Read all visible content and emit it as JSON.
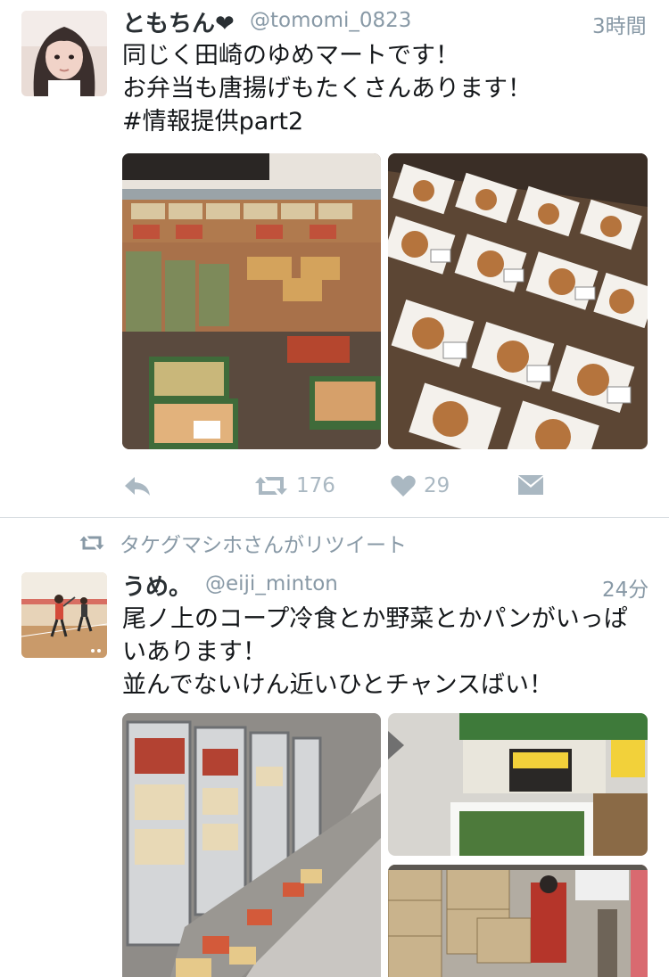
{
  "tweets": [
    {
      "author_name": "ともちん❤",
      "handle": "@tomomi_0823",
      "time": "3時間",
      "lines": [
        "同じく田崎のゆめマートです！",
        "お弁当も唐揚げもたくさんあります！",
        "#情報提供part2"
      ],
      "photos": [
        "bento-counter-photo",
        "karaage-trays-photo"
      ],
      "actions": {
        "reply_icon": "reply-icon",
        "retweet_count": "176",
        "like_count": "29",
        "dm_icon": "dm-icon"
      }
    },
    {
      "retweet_context": "タケグマシホさんがリツイート",
      "author_name": "うめ。",
      "handle": "@eiji_minton",
      "time": "24分",
      "lines": [
        "尾ノ上のコープ冷食とか野菜とかパンがいっぱ",
        "いあります！",
        "並んでないけん近いひとチャンスばい！"
      ],
      "photos": [
        "freezer-aisle-photo",
        "broccoli-box-photo",
        "stockroom-photo"
      ]
    }
  ],
  "colors": {
    "icon_gray": "#aab8c2",
    "meta_gray": "#8899a6",
    "text": "#14171a",
    "divider": "#d8dde1"
  }
}
